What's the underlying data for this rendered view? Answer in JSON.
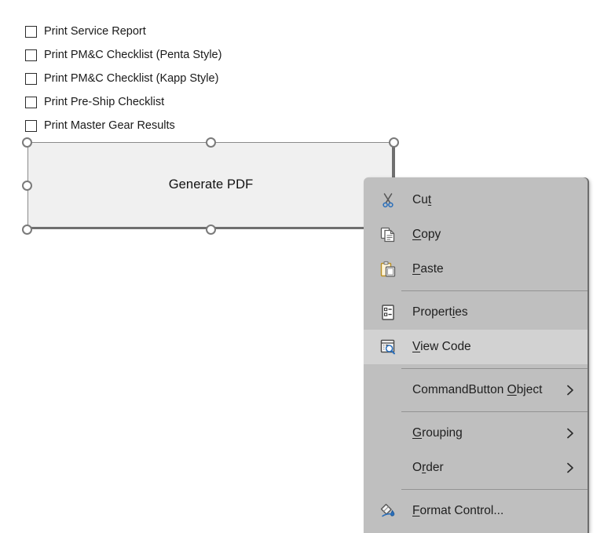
{
  "checkboxes": {
    "items": [
      {
        "label": "Print Service Report",
        "checked": false
      },
      {
        "label": "Print PM&C Checklist (Penta Style)",
        "checked": false
      },
      {
        "label": "Print PM&C Checklist (Kapp Style)",
        "checked": false
      },
      {
        "label": "Print Pre-Ship Checklist",
        "checked": false
      },
      {
        "label": "Print Master Gear Results",
        "checked": false
      }
    ]
  },
  "button": {
    "label": "Generate PDF",
    "selected": true,
    "fill_color": "#f0f0f0",
    "border_color": "#8a8a8a",
    "handle_color": "#7a7a7a"
  },
  "context_menu": {
    "background_color": "#bfbfbf",
    "highlight_color": "#d2d2d2",
    "items": [
      {
        "id": "cut",
        "icon": "scissors-icon",
        "label_pre": "Cu",
        "label_mnemonic": "t",
        "label_post": "",
        "full_label": "Cut",
        "submenu": false,
        "highlighted": false
      },
      {
        "id": "copy",
        "icon": "copy-icon",
        "label_pre": "",
        "label_mnemonic": "C",
        "label_post": "opy",
        "full_label": "Copy",
        "submenu": false,
        "highlighted": false
      },
      {
        "id": "paste",
        "icon": "clipboard-paste-icon",
        "label_pre": "",
        "label_mnemonic": "P",
        "label_post": "aste",
        "full_label": "Paste",
        "submenu": false,
        "highlighted": false
      },
      {
        "id": "sep1",
        "separator": true
      },
      {
        "id": "properties",
        "icon": "properties-list-icon",
        "label_pre": "Propert",
        "label_mnemonic": "i",
        "label_post": "es",
        "full_label": "Properties",
        "submenu": false,
        "highlighted": false
      },
      {
        "id": "view-code",
        "icon": "view-code-icon",
        "label_pre": "",
        "label_mnemonic": "V",
        "label_post": "iew Code",
        "full_label": "View Code",
        "submenu": false,
        "highlighted": true
      },
      {
        "id": "sep2",
        "separator": true
      },
      {
        "id": "commandbutton-object",
        "icon": "none",
        "label_pre": "CommandButton ",
        "label_mnemonic": "O",
        "label_post": "bject",
        "full_label": "CommandButton Object",
        "submenu": true,
        "highlighted": false
      },
      {
        "id": "sep3",
        "separator": true
      },
      {
        "id": "grouping",
        "icon": "none",
        "label_pre": "",
        "label_mnemonic": "G",
        "label_post": "rouping",
        "full_label": "Grouping",
        "submenu": true,
        "highlighted": false
      },
      {
        "id": "order",
        "icon": "none",
        "label_pre": "O",
        "label_mnemonic": "r",
        "label_post": "der",
        "full_label": "Order",
        "submenu": true,
        "highlighted": false
      },
      {
        "id": "sep4",
        "separator": true
      },
      {
        "id": "format-control",
        "icon": "format-control-icon",
        "label_pre": "",
        "label_mnemonic": "F",
        "label_post": "ormat Control...",
        "full_label": "Format Control...",
        "submenu": false,
        "highlighted": false
      }
    ],
    "submenu_arrow_glyph": "›"
  }
}
